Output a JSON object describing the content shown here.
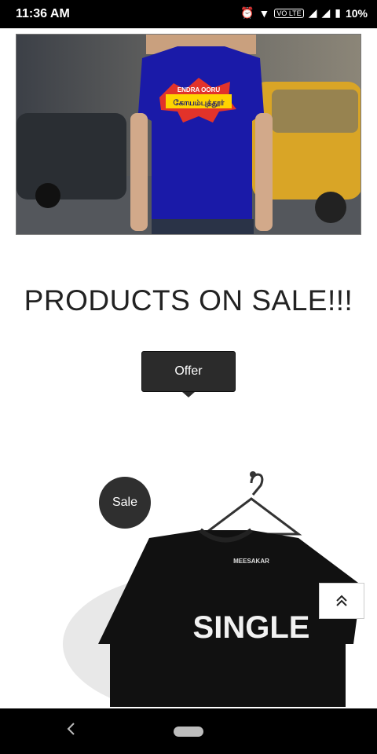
{
  "status_bar": {
    "time": "11:36 AM",
    "battery": "10%",
    "network_label": "VO LTE"
  },
  "hero": {
    "shirt_text_top": "ENDRA OORU",
    "shirt_text_main": "கோயம்புத்தூர்"
  },
  "section": {
    "title": "PRODUCTS ON SALE!!!",
    "offer_label": "Offer"
  },
  "product": {
    "badge": "Sale",
    "brand": "MEESAKAR",
    "shirt_text": "SINGLE"
  },
  "colors": {
    "badge_bg": "#2f2f2f",
    "button_bg": "#2b2b2b",
    "hero_shirt": "#1a1aa8"
  },
  "icons": {
    "scroll_top": "double-chevron-up-icon",
    "nav_back": "back-icon",
    "nav_home": "home-pill-icon"
  }
}
